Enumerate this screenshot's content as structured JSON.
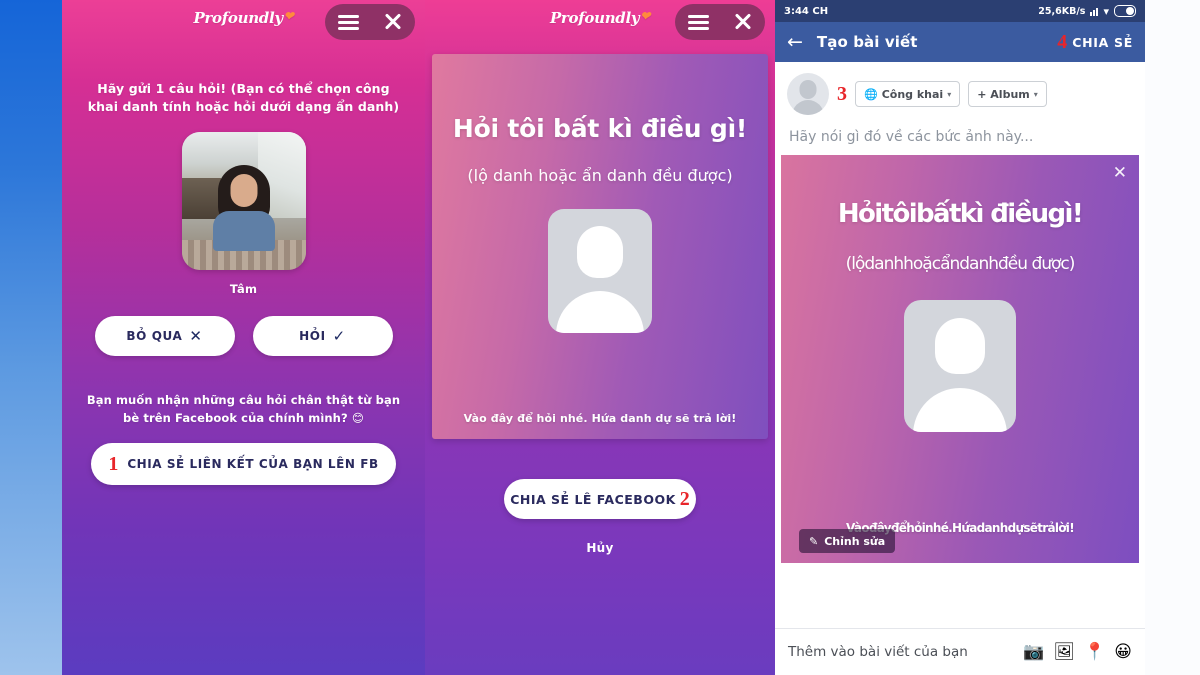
{
  "panel1": {
    "logo": "Profoundly",
    "logo_mark": "heart-icon",
    "menu_icon": "hamburger-menu-icon",
    "close_icon": "close-icon",
    "headline": "Hãy gửi 1 câu hỏi! (Bạn có thể chọn công khai danh tính hoặc hỏi dưới dạng ẩn danh)",
    "person_name": "Tâm",
    "skip_label": "BỎ QUA",
    "skip_glyph": "✕",
    "ask_label": "HỎI",
    "ask_glyph": "✓",
    "subtext": "Bạn muốn nhận những câu hỏi chân thật từ bạn bè trên Facebook của chính mình? 😊",
    "share_step": "1",
    "share_label": "CHIA SẺ LIÊN KẾT CỦA BẠN LÊN FB"
  },
  "panel2": {
    "logo": "Profoundly",
    "menu_icon": "hamburger-menu-icon",
    "close_icon": "close-icon",
    "card_title": "Hỏi tôi bất kì điều gì!",
    "card_subtitle": "(lộ danh hoặc ẩn danh đều được)",
    "card_footer": "Vào đây để hỏi nhé. Hứa danh dự sẽ trả lời!",
    "share_step": "2",
    "share_label": "CHIA SẺ LÊ FACEBOOK",
    "cancel_label": "Hủy"
  },
  "panel3": {
    "status": {
      "time": "3:44 CH",
      "speed": "25,6KB/s",
      "signal_icon": "signal-bars-icon",
      "wifi_icon": "wifi-icon",
      "battery_icon": "battery-icon"
    },
    "appbar": {
      "back_icon": "back-arrow-icon",
      "title": "Tạo bài viết",
      "share_step": "4",
      "share_label": "CHIA SẺ"
    },
    "compose": {
      "avatar": "default-avatar-icon",
      "privacy_step": "3",
      "privacy_icon": "globe-icon",
      "privacy_label": "Công khai",
      "privacy_caret": "▾",
      "album_label": "+ Album",
      "album_caret": "▾",
      "placeholder": "Hãy nói gì đó về các bức ảnh này..."
    },
    "image_card": {
      "close_icon": "close-icon",
      "title": "Hỏitôibấtkì điềugì!",
      "subtitle": "(lộdanhhoặcẩndanhđều được)",
      "footer": "Vàođâyđểhỏinhé.Hứadanhdựsẽtrảlời!",
      "edit_icon": "pencil-icon",
      "edit_label": "Chỉnh sửa"
    },
    "addbar": {
      "label": "Thêm vào bài viết của bạn",
      "icons": [
        {
          "name": "camera-icon",
          "glyph": "📷"
        },
        {
          "name": "photo-gallery-icon",
          "glyph": "🖼"
        },
        {
          "name": "location-pin-icon",
          "glyph": "📍"
        },
        {
          "name": "emoji-smiley-icon",
          "glyph": "😀"
        }
      ]
    }
  },
  "colors": {
    "pink": "#ec3f96",
    "purple": "#7135b8",
    "blue_strip": "#1565d8",
    "fb_blue": "#3b5ba0",
    "step_red": "#e8252a"
  }
}
